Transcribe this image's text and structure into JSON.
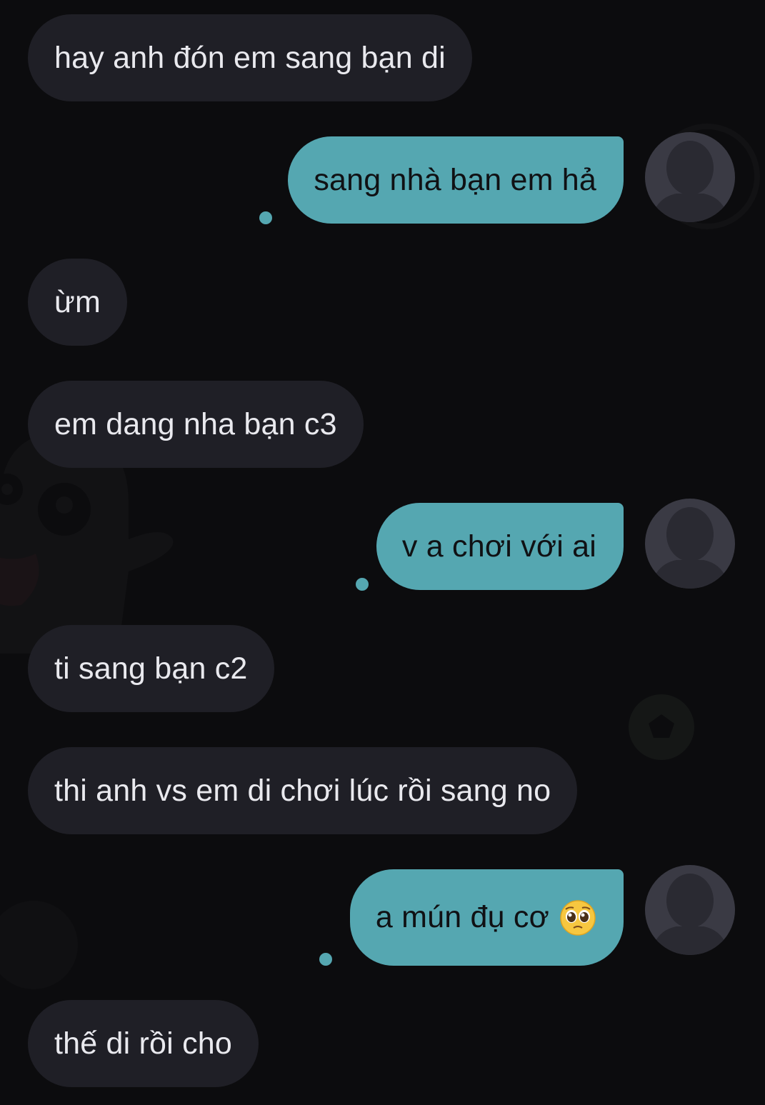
{
  "theme": {
    "background": "#0c0c0e",
    "incoming_bubble": "#1f1f26",
    "incoming_text": "#e9e9ee",
    "outgoing_bubble": "#55a7b1",
    "outgoing_text": "#101114",
    "avatar": "#3a3a44"
  },
  "messages": [
    {
      "direction": "incoming",
      "text": "hay anh đón em sang bạn di"
    },
    {
      "direction": "outgoing",
      "text": "sang nhà bạn em hả",
      "status_icon": "sent-dot-icon",
      "avatar_icon": "default-avatar-icon"
    },
    {
      "direction": "incoming",
      "text": "ừm"
    },
    {
      "direction": "incoming",
      "text": "em dang nha bạn c3"
    },
    {
      "direction": "outgoing",
      "text": "v a chơi với ai",
      "status_icon": "sent-dot-icon",
      "avatar_icon": "default-avatar-icon"
    },
    {
      "direction": "incoming",
      "text": "ti sang bạn c2"
    },
    {
      "direction": "incoming",
      "text": "thi anh vs em di chơi lúc rồi sang no"
    },
    {
      "direction": "outgoing",
      "text": "a mún đụ cơ",
      "emoji": "pleading-face-emoji",
      "status_icon": "sent-dot-icon",
      "avatar_icon": "default-avatar-icon"
    },
    {
      "direction": "incoming",
      "text": "thế di rồi cho"
    }
  ]
}
